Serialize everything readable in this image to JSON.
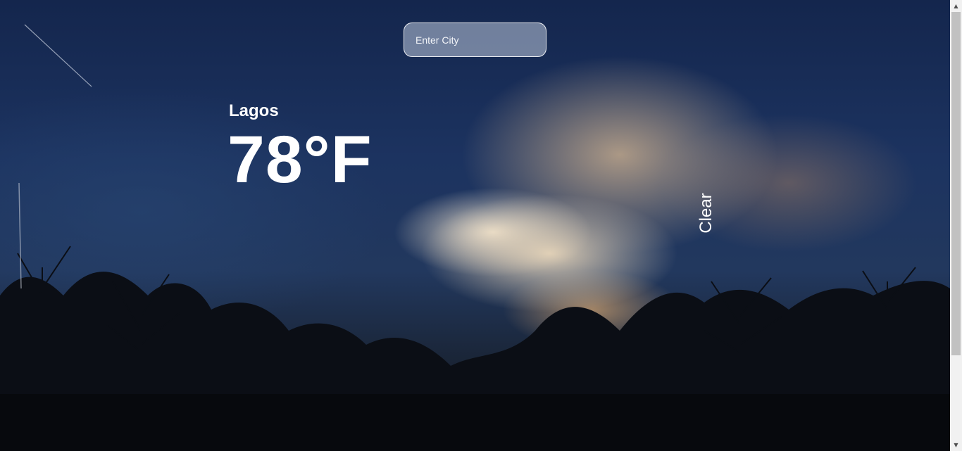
{
  "search": {
    "placeholder": "Enter City",
    "value": ""
  },
  "weather": {
    "city": "Lagos",
    "temperature": "78°F",
    "condition": "Clear"
  },
  "scrollbar": {
    "up_icon": "▲",
    "down_icon": "▼"
  },
  "colors": {
    "sky_top": "#14264d",
    "ground": "#10131a",
    "text": "#ffffff"
  }
}
